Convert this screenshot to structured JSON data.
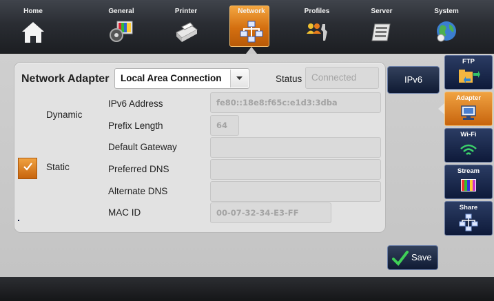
{
  "nav": {
    "items": [
      {
        "label": "Home",
        "icon": "home-icon"
      },
      {
        "label": "General",
        "icon": "general-icon"
      },
      {
        "label": "Printer",
        "icon": "printer-icon"
      },
      {
        "label": "Network",
        "icon": "network-icon",
        "active": true
      },
      {
        "label": "Profiles",
        "icon": "profiles-icon"
      },
      {
        "label": "Server",
        "icon": "server-icon"
      },
      {
        "label": "System",
        "icon": "system-globe-icon"
      }
    ]
  },
  "adapter": {
    "title": "Network Adapter",
    "selected": "Local Area Connection",
    "status_label": "Status",
    "status_value": "Connected"
  },
  "mode": {
    "dynamic_label": "Dynamic",
    "dynamic_checked": true,
    "static_label": "Static",
    "static_checked": false
  },
  "fields": {
    "ipv6_address_label": "IPv6 Address",
    "ipv6_address_value": "fe80::18e8:f65c:e1d3:3dba",
    "prefix_length_label": "Prefix Length",
    "prefix_length_value": "64",
    "default_gateway_label": "Default Gateway",
    "default_gateway_value": "",
    "preferred_dns_label": "Preferred DNS",
    "preferred_dns_value": "",
    "alternate_dns_label": "Alternate DNS",
    "alternate_dns_value": "",
    "mac_id_label": "MAC ID",
    "mac_id_value": "00-07-32-34-E3-FF"
  },
  "buttons": {
    "ipv6": "IPv6",
    "save": "Save"
  },
  "side_tabs": [
    {
      "label": "FTP",
      "icon": "ftp-folder-icon"
    },
    {
      "label": "Adapter",
      "icon": "adapter-monitor-icon",
      "active": true
    },
    {
      "label": "Wi-Fi",
      "icon": "wifi-icon"
    },
    {
      "label": "Stream",
      "icon": "stream-colorbars-icon"
    },
    {
      "label": "Share",
      "icon": "share-network-icon"
    }
  ],
  "colors": {
    "accent_orange": "#e08a25",
    "nav_dark": "#2a2d33",
    "button_navy": "#0f1a33"
  }
}
